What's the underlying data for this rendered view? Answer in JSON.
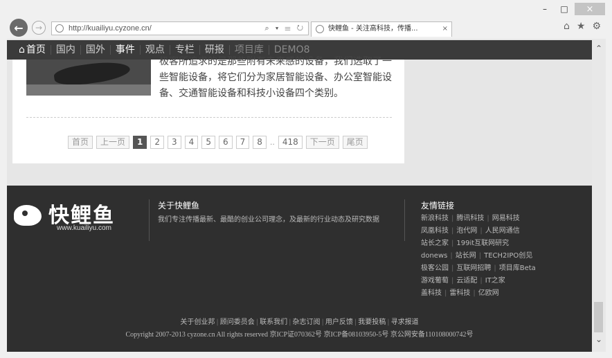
{
  "window": {
    "minimize": "–",
    "maximize": "□",
    "close": "×"
  },
  "browser": {
    "back": "←",
    "forward": "→",
    "url": "http://kuailiyu.cyzone.cn/",
    "addr_tools": "⌕ ▾ ☰ ↻",
    "tab_title": "快鲤鱼 - 关注高科技，传播...",
    "tab_close": "×",
    "home": "⌂",
    "favorites": "★",
    "settings": "⚙"
  },
  "nav": {
    "items": [
      "首页",
      "国内",
      "国外",
      "事件",
      "观点",
      "专栏",
      "研报",
      "项目库",
      "DEMO8"
    ],
    "collapse": "⌃"
  },
  "article": {
    "text": "极客所追求的是那些附有未来感的设备，我们选取了一些智能设备，将它们分为家居智能设备、办公室智能设备、交通智能设备和科技小设备四个类别。"
  },
  "pager": {
    "first": "首页",
    "prev": "上一页",
    "pages": [
      "1",
      "2",
      "3",
      "4",
      "5",
      "6",
      "7",
      "8"
    ],
    "current": "1",
    "ellipsis": "..",
    "last_page": "418",
    "next": "下一页",
    "end": "尾页"
  },
  "footer": {
    "logo_text": "快鲤鱼",
    "logo_url": "www.kuailiyu.com",
    "about_title": "关于快鲤鱼",
    "about_text": "我们专注传播最新、最酷的创业公司理念，及最新的行业动态及研究数据",
    "links_title": "友情链接",
    "link_rows": [
      [
        "新浪科技",
        "腾讯科技",
        "网易科技"
      ],
      [
        "凤凰科技",
        "泡代网",
        "人民网通信"
      ],
      [
        "站长之家",
        "199it互联网研究"
      ],
      [
        "donews",
        "站长网",
        "TECH2IPO创见"
      ],
      [
        "极客公园",
        "互联网招聘",
        "项目库Beta"
      ],
      [
        "游戏葡萄",
        "云适配",
        "IT之家"
      ],
      [
        "盖科技",
        "雷科技",
        "亿欧网"
      ]
    ],
    "bottom_links": [
      "关于创业邦",
      "顾问委员会",
      "联系我们",
      "杂志订阅",
      "用户反馈",
      "我要投稿",
      "寻求报道"
    ],
    "copyright": "Copyright 2007-2013 cyzone.cn All rights reserved 京ICP证070362号 京ICP备08103950-5号 京公网安备110108000742号"
  },
  "scrollbar": {
    "up": "⌃",
    "down": "⌄"
  },
  "colors": {
    "nav_bg": "#3b3b3b",
    "footer_bg": "#2f2f2f",
    "current_page": "#555555"
  }
}
